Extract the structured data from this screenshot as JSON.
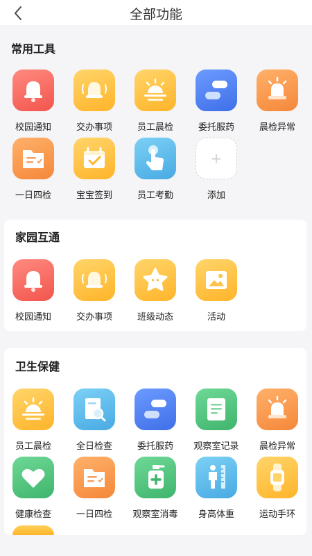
{
  "nav": {
    "title": "全部功能",
    "back_icon": "chevron-left-icon"
  },
  "sections": [
    {
      "title": "常用工具",
      "items": [
        {
          "label": "校园通知",
          "icon": "bell-icon",
          "color": "#f2635a"
        },
        {
          "label": "交办事项",
          "icon": "ringing-bell-icon",
          "color": "#ffbe3a"
        },
        {
          "label": "员工晨检",
          "icon": "sunrise-icon",
          "color": "#ffbe3a"
        },
        {
          "label": "委托服药",
          "icon": "pill-icon",
          "color": "#4a7cf2"
        },
        {
          "label": "晨检异常",
          "icon": "alarm-light-icon",
          "color": "#f7913d"
        },
        {
          "label": "一日四检",
          "icon": "folder-checklist-icon",
          "color": "#f7913d"
        },
        {
          "label": "宝宝签到",
          "icon": "calendar-check-icon",
          "color": "#ffbe3a"
        },
        {
          "label": "员工考勤",
          "icon": "tap-finger-icon",
          "color": "#58b6ea"
        },
        {
          "label": "添加",
          "icon": "add-icon",
          "symbol": "+"
        }
      ]
    },
    {
      "title": "家园互通",
      "items": [
        {
          "label": "校园通知",
          "icon": "bell-icon",
          "color": "#f2635a"
        },
        {
          "label": "交办事项",
          "icon": "ringing-bell-icon",
          "color": "#ffbe3a"
        },
        {
          "label": "班级动态",
          "icon": "star-icon",
          "color": "#ffbe3a"
        },
        {
          "label": "活动",
          "icon": "picture-icon",
          "color": "#ffbe3a"
        }
      ]
    },
    {
      "title": "卫生保健",
      "items": [
        {
          "label": "员工晨检",
          "icon": "sunrise-icon",
          "color": "#ffbe3a"
        },
        {
          "label": "全日检查",
          "icon": "magnifier-doc-icon",
          "color": "#58b6ea"
        },
        {
          "label": "委托服药",
          "icon": "pill-icon",
          "color": "#4a7cf2"
        },
        {
          "label": "观察室记录",
          "icon": "document-icon",
          "color": "#4cc37a"
        },
        {
          "label": "晨检异常",
          "icon": "alarm-light-icon",
          "color": "#f7913d"
        },
        {
          "label": "健康检查",
          "icon": "heart-icon",
          "color": "#4cc37a"
        },
        {
          "label": "一日四检",
          "icon": "folder-checklist-icon",
          "color": "#f7913d"
        },
        {
          "label": "观察室消毒",
          "icon": "sanitizer-icon",
          "color": "#4cc37a"
        },
        {
          "label": "身高体重",
          "icon": "height-ruler-icon",
          "color": "#58b6ea"
        },
        {
          "label": "运动手环",
          "icon": "smartwatch-icon",
          "color": "#ffbe3a"
        }
      ]
    }
  ]
}
